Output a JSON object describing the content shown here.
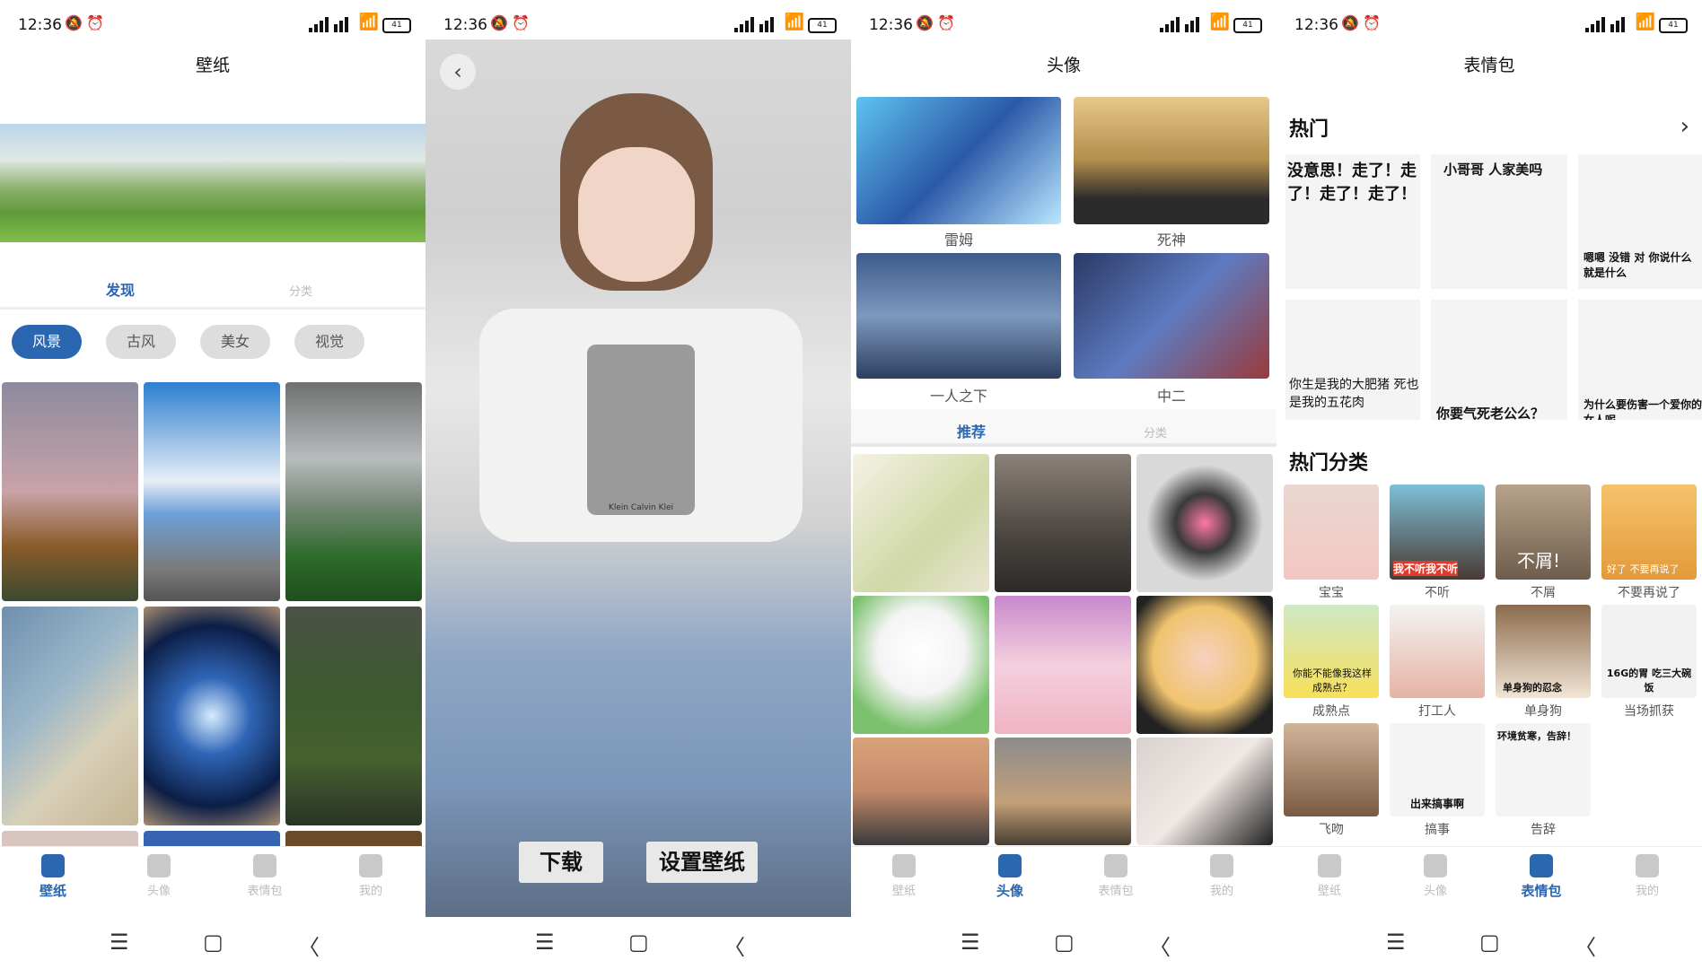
{
  "status": {
    "time": "12:36",
    "battery": "41"
  },
  "nav_bottom": {
    "menu": "☰",
    "home": "▢",
    "back": "〈"
  },
  "tabbar": {
    "items": [
      "壁纸",
      "头像",
      "表情包",
      "我的"
    ]
  },
  "screen1": {
    "title": "壁纸",
    "segments": [
      "发现",
      "分类"
    ],
    "chips": [
      "风景",
      "古风",
      "美女",
      "视觉"
    ]
  },
  "screen2": {
    "download": "下载",
    "set_wallpaper": "设置壁纸",
    "photo_text": "Klein   Calvin Klei"
  },
  "screen3": {
    "title": "头像",
    "featured": [
      "雷姆",
      "死神",
      "一人之下",
      "中二"
    ],
    "segments": [
      "推荐",
      "分类"
    ]
  },
  "screen4": {
    "title": "表情包",
    "hot": "热门",
    "hot_category": "热门分类",
    "memes": [
      "没意思！走了！走了！走了！走了！",
      "小哥哥 人家美吗",
      "嗯嗯 没错 对 你说什么就是什么",
      "你生是我的大肥猪 死也是我的五花肉",
      "你要气死老公么？",
      "为什么要伤害一个爱你的女人呢"
    ],
    "category_overlays": [
      "我不听我不听",
      "不屑!",
      "好了 不要再说了",
      "你能不能像我这样成熟点？",
      "单身狗的忍念",
      "16G的胃 吃三大碗饭",
      "出来搞事啊",
      "环境贫寒，告辞！"
    ],
    "categories": [
      "宝宝",
      "不听",
      "不屑",
      "不要再说了",
      "成熟点",
      "打工人",
      "单身狗",
      "当场抓获",
      "飞吻",
      "搞事",
      "告辞"
    ]
  },
  "colors": {
    "accent": "#2b66b0"
  }
}
